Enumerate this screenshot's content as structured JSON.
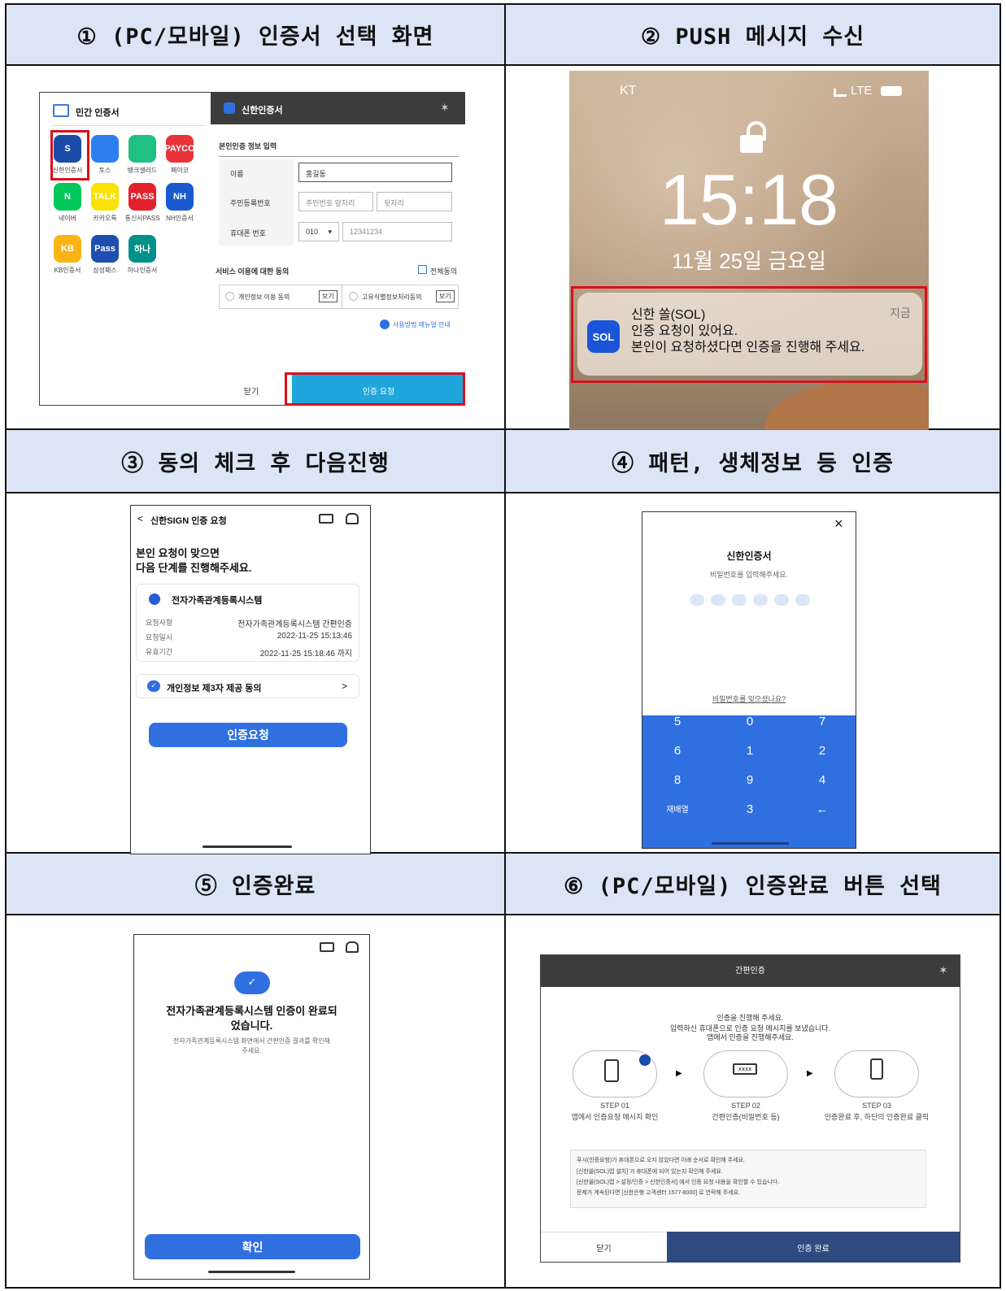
{
  "headers": {
    "h1": "① (PC/모바일) 인증서 선택 화면",
    "h2": "② PUSH 메시지 수신",
    "h3": "③ 동의 체크 후 다음진행",
    "h4": "④ 패턴, 생체정보 등 인증",
    "h5": "⑤ 인증완료",
    "h6": "⑥ (PC/모바일) 인증완료 버튼 선택"
  },
  "p1": {
    "left_title": "민간 인증서",
    "right_title": "신한인증서",
    "certs": [
      {
        "label": "신한인증서",
        "color": "#1a4ba8",
        "text": "S"
      },
      {
        "label": "토스",
        "color": "#2f7ef0",
        "text": ""
      },
      {
        "label": "뱅크샐러드",
        "color": "#20c080",
        "text": ""
      },
      {
        "label": "페이코",
        "color": "#e8333a",
        "text": "PAYCO"
      },
      {
        "label": "네이버",
        "color": "#03c75a",
        "text": "N"
      },
      {
        "label": "카카오톡",
        "color": "#fae100",
        "text": "TALK"
      },
      {
        "label": "통신사PASS",
        "color": "#e5202e",
        "text": "PASS"
      },
      {
        "label": "NH인증서",
        "color": "#1a5ad0",
        "text": "NH"
      },
      {
        "label": "KB인증서",
        "color": "#fbb414",
        "text": "KB"
      },
      {
        "label": "삼성패스",
        "color": "#1e4fb0",
        "text": "Pass"
      },
      {
        "label": "하나인증서",
        "color": "#00908a",
        "text": "하나"
      }
    ],
    "section": "본인인증 정보 입력",
    "name_label": "이름",
    "name_value": "홍길동",
    "rrn_label": "주민등록번호",
    "rrn_front": "주민번호 앞자리",
    "rrn_back": "뒷자리",
    "phone_label": "휴대폰 번호",
    "phone_prefix": "010",
    "phone_value": "12341234",
    "agree_title": "서비스 이용에 대한 동의",
    "agree_all": "전체동의",
    "agree1": "개인정보 이용 동의",
    "agree2": "고유식별정보처리동의",
    "view": "보기",
    "manual": "사용방법 매뉴얼 안내",
    "close": "닫기",
    "request": "인증 요청"
  },
  "p2": {
    "carrier": "KT",
    "network": "LTE",
    "time": "15:18",
    "date": "11월 25일 금요일",
    "app": "신한 쏠(SOL)",
    "when": "지금",
    "line1": "인증 요청이 있어요.",
    "line2": "본인이 요청하셨다면 인증을 진행해 주세요.",
    "app_icon": "SOL"
  },
  "p3": {
    "title": "신한SIGN 인증 요청",
    "heading1": "본인 요청이 맞으면",
    "heading2": "다음 단계를 진행해주세요.",
    "org": "전자가족관계등록시스템",
    "r1k": "요청사항",
    "r1v": "전자가족관계등록시스템 간편인증",
    "r2k": "요청일시",
    "r2v": "2022-11-25 15:13:46",
    "r3k": "유효기간",
    "r3v": "2022-11-25 15:18:46 까지",
    "consent": "개인정보 제3자 제공 동의",
    "button": "인증요청"
  },
  "p4": {
    "title": "신한인증서",
    "sub": "비밀번호를 입력해주세요.",
    "forgot": "비밀번호를 잊으셨나요?",
    "keys": [
      "5",
      "0",
      "7",
      "6",
      "1",
      "2",
      "8",
      "9",
      "4",
      "재배열",
      "3",
      "←"
    ]
  },
  "p5": {
    "title1": "전자가족관계등록시스템 인증이 완료되",
    "title2": "었습니다.",
    "desc1": "전자가족관계등록시스템 화면에서 간편인증 결과를 확인해",
    "desc2": "주세요.",
    "button": "확인"
  },
  "p6": {
    "title": "간편인증",
    "l1": "인증을 진행해 주세요.",
    "l2": "입력하신 휴대폰으로 인증 요청 메시지를 보냈습니다.",
    "l3": "앱에서 인증을 진행해주세요.",
    "s1a": "STEP 01",
    "s1b": "앱에서 인증요청 메시지 확인",
    "s2a": "STEP 02",
    "s2b": "간편인증(비밀번호 등)",
    "s3a": "STEP 03",
    "s3b": "인증완료 후, 하단의 인증완료 클릭",
    "n0": "푸시(인증요청)가 휴대폰으로 오지 않았다면 아래 순서로 확인해 주세요.",
    "n1": "[신한쏠(SOL)앱 설치] 가 휴대폰에 되어 있는지 확인해 주세요.",
    "n2": "[신한쏠(SOL)앱 > 설정/인증 > 신한인증서] 에서 인증 요청 내용을 확인할 수 있습니다.",
    "n3": "문제가 계속된다면 [신한은행 고객센터 1577-8000] 로 연락해 주세요.",
    "close": "닫기",
    "done": "인증 완료"
  }
}
